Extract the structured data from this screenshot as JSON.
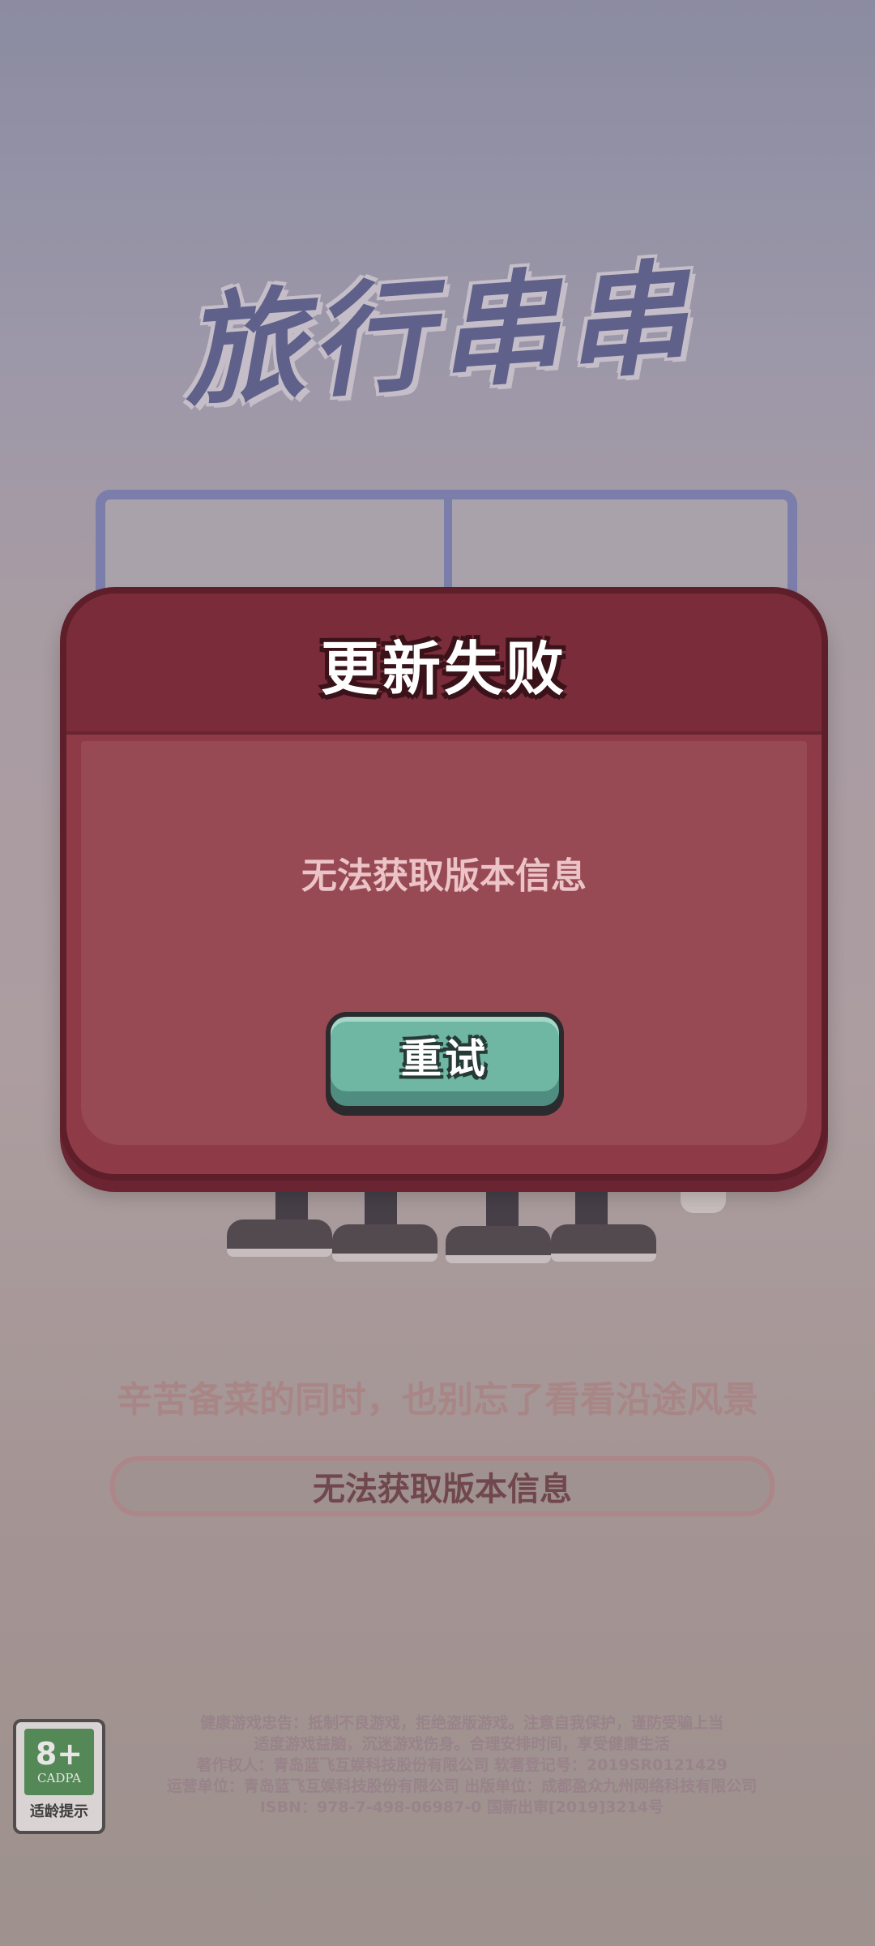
{
  "game": {
    "logo_text": "旅行串串"
  },
  "dialog": {
    "title": "更新失败",
    "message": "无法获取版本信息",
    "retry_label": "重试"
  },
  "loading": {
    "tagline": "辛苦备菜的同时，也别忘了看看沿途风景",
    "status": "无法获取版本信息"
  },
  "age_rating": {
    "age": "8+",
    "org": "CADPA",
    "label": "适龄提示"
  },
  "footer": {
    "lines": [
      "健康游戏忠告：抵制不良游戏，拒绝盗版游戏。注意自我保护，谨防受骗上当",
      "适度游戏益脑，沉迷游戏伤身。合理安排时间，享受健康生活",
      "著作权人：青岛蓝飞互娱科技股份有限公司   软著登记号：2019SR0121429",
      "运营单位：青岛蓝飞互娱科技股份有限公司   出版单位：成都盈众九州网络科技有限公司",
      "ISBN：978-7-498-06987-0   国新出审[2019]3214号"
    ]
  },
  "colors": {
    "dialog_bg": "#8e3b47",
    "dialog_header": "#7a2c3a",
    "button_green": "#6fb6a3",
    "logo_blue": "#5a5f92"
  }
}
